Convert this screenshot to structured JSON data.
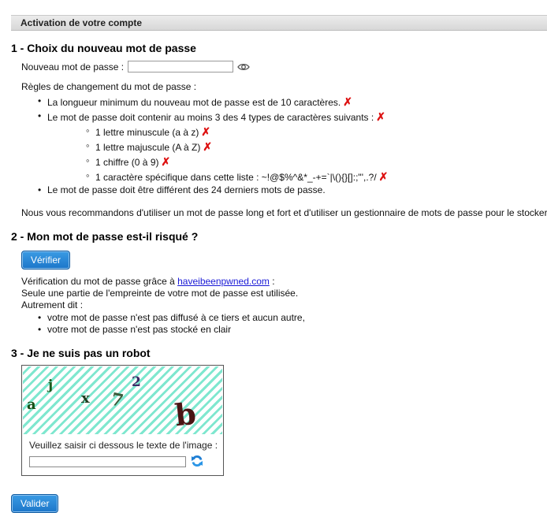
{
  "panel": {
    "title": "Activation de votre compte"
  },
  "section1": {
    "heading": "1 - Choix du nouveau mot de passe",
    "password_label": "Nouveau mot de passe :",
    "password_value": "",
    "rules_title": "Règles de changement du mot de passe :",
    "rules": [
      "La longueur minimum du nouveau mot de passe est de 10 caractères.",
      "Le mot de passe doit contenir au moins 3 des 4 types de caractères suivants :",
      "Le mot de passe doit être différent des 24 derniers mots de passe."
    ],
    "char_types": [
      "1 lettre minuscule (a à z)",
      "1 lettre majuscule (A à Z)",
      "1 chiffre (0 à 9)",
      "1 caractère spécifique dans cette liste : ~!@$%^&*_-+=`|\\(){}[]:;\"',.?/"
    ],
    "fail_mark": "✗",
    "recommendation": "Nous vous recommandons d'utiliser un mot de passe long et fort et d'utiliser un gestionnaire de mots de passe pour le stocker"
  },
  "section2": {
    "heading": "2 - Mon mot de passe est-il risqué ?",
    "button": "Vérifier",
    "verify_prefix": "Vérification du mot de passe grâce à",
    "verify_link": "haveibeenpwned.com",
    "verify_suffix": ":",
    "line2": "Seule une partie de l'empreinte de votre mot de passe est utilisée.",
    "line3": "Autrement dit :",
    "bullets": [
      "votre mot de passe n'est pas diffusé à ce tiers et aucun autre,",
      "votre mot de passe n'est pas stocké en clair"
    ]
  },
  "section3": {
    "heading": "3 - Je ne suis pas un robot",
    "captcha_chars": [
      "a",
      "j",
      "x",
      "7",
      "2",
      "b"
    ],
    "captcha_prompt": "Veuillez saisir ci dessous le texte de l'image :",
    "captcha_value": ""
  },
  "submit": {
    "label": "Valider"
  },
  "colors": {
    "button": "#1c76c9",
    "stripe": "#7fe7cf",
    "fail": "#dd1111",
    "link": "#1a1ad6"
  }
}
